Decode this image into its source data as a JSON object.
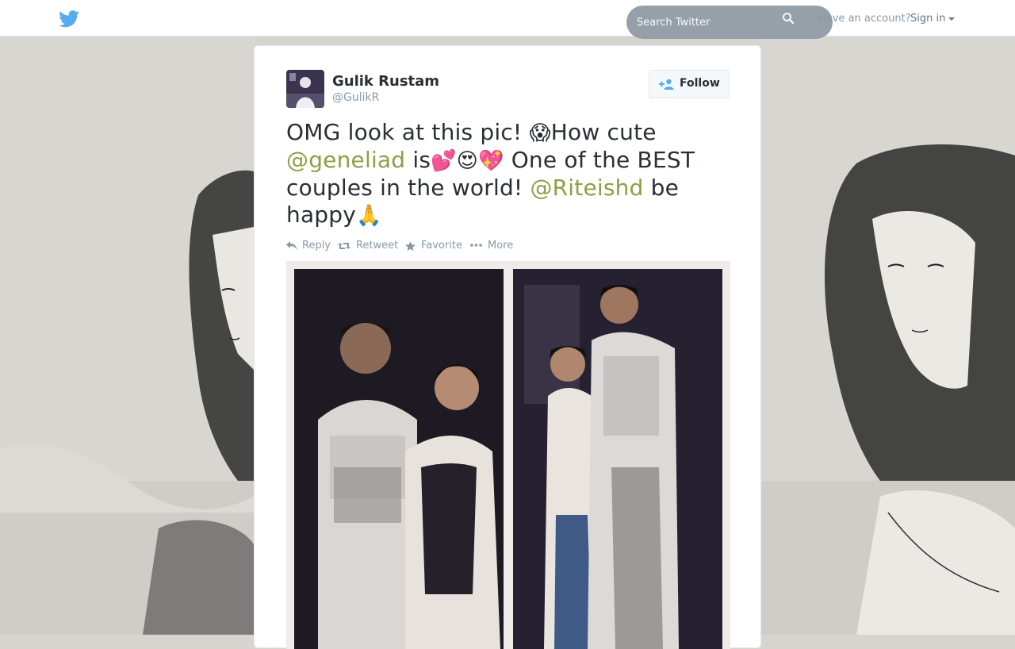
{
  "header": {
    "search_placeholder": "Search Twitter",
    "have_account": "Have an account?",
    "sign_in": "Sign in"
  },
  "tweet": {
    "author": {
      "name": "Gulik Rustam",
      "handle": "@GulikR"
    },
    "follow_label": "Follow",
    "text": {
      "part1": "OMG look at this pic! ",
      "emoji_scream": "😱",
      "part2": "How cute ",
      "mention1": "@geneliad",
      "part3": " is",
      "emoji_hearts": "💕😍💖",
      "part4": " One of the BEST couples in the world! ",
      "mention2": "@Riteishd",
      "part5": " be happy",
      "emoji_pray": "🙏"
    },
    "actions": {
      "reply": "Reply",
      "retweet": "Retweet",
      "favorite": "Favorite",
      "more": "More"
    }
  },
  "colors": {
    "twitter_blue": "#55acee",
    "mention": "#8ba045",
    "search_bg": "#96a0a8",
    "action_gray": "#8899a6"
  }
}
